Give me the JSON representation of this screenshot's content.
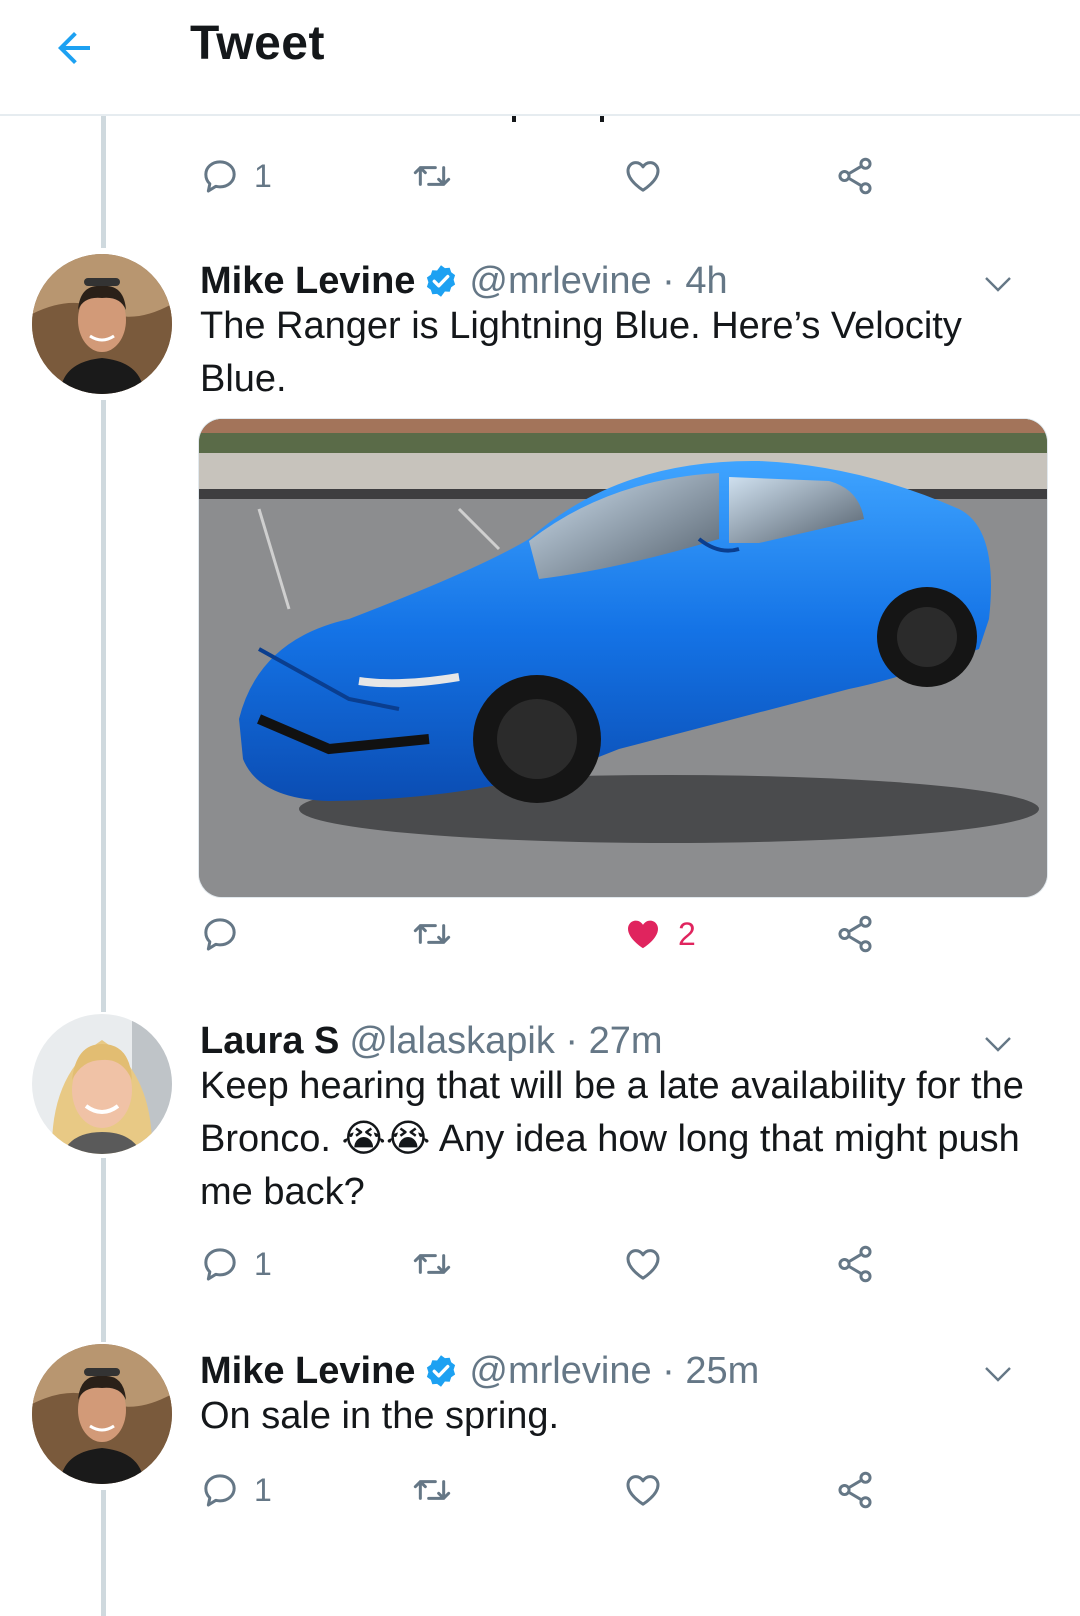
{
  "header": {
    "title": "Tweet",
    "back_icon": "arrow-left-icon"
  },
  "colors": {
    "accent": "#1da1f2",
    "like_active": "#e0245e",
    "muted": "#657786",
    "thread_line": "#cfd9de"
  },
  "top_actions": {
    "reply_count": "1",
    "like_count": ""
  },
  "tweets": [
    {
      "name": "Mike Levine",
      "verified": true,
      "handle": "@mrlevine · 4h",
      "text": "The Ranger is Lightning Blue. Here’s Velocity Blue.",
      "has_media": true,
      "reply_count": "",
      "like_count": "2",
      "liked": true
    },
    {
      "name": "Laura S",
      "verified": false,
      "handle": "@lalaskapik · 27m",
      "text_before": "Keep hearing that will be a late availability for the Bronco.",
      "emoji": "😭😭",
      "text_after": "Any idea how long that might push me back?",
      "reply_count": "1",
      "like_count": "",
      "liked": false
    },
    {
      "name": "Mike Levine",
      "verified": true,
      "handle": "@mrlevine · 25m",
      "text": "On sale in the spring.",
      "reply_count": "1",
      "like_count": "",
      "liked": false
    }
  ]
}
